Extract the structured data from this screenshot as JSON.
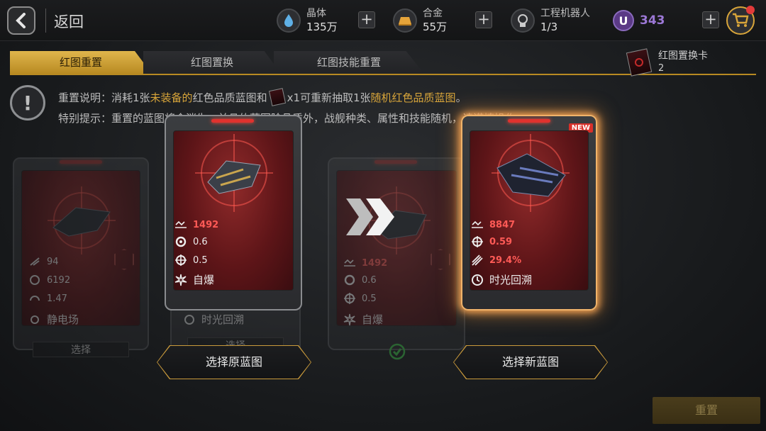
{
  "topbar": {
    "back_label": "返回",
    "resources": [
      {
        "name": "晶体",
        "value": "135万",
        "icon": "crystal-icon"
      },
      {
        "name": "合金",
        "value": "55万",
        "icon": "alloy-icon"
      },
      {
        "name": "工程机器人",
        "value": "1/3",
        "icon": "robot-icon"
      }
    ],
    "currency_u": {
      "icon_letter": "U",
      "value": "343"
    }
  },
  "tabs": [
    {
      "label": "红图重置",
      "active": true
    },
    {
      "label": "红图置换",
      "active": false
    },
    {
      "label": "红图技能重置",
      "active": false
    }
  ],
  "item": {
    "name": "红图置换卡",
    "count": "2"
  },
  "notice": {
    "line1": {
      "a": "重置说明：消耗1张",
      "b": "未装备的",
      "c": "红色品质蓝图和",
      "d": "x1可重新抽取1张",
      "e": "随机红色品质蓝图",
      "f": "。"
    },
    "line2": "特别提示：重置的蓝图将会消失，并且的蓝图除品质外，战舰种类、属性和技能随机，请谨慎操作"
  },
  "cards": {
    "left_back": {
      "stats": [
        "94",
        "6192",
        "1.47"
      ],
      "skill": "静电场",
      "select": "选择"
    },
    "original": {
      "power": "1492",
      "stat1": "0.6",
      "stat2": "0.5",
      "skill": "自爆"
    },
    "original_under": {
      "skill": "时光回溯",
      "select": "选择"
    },
    "middle_back": {
      "power": "1492",
      "stat1": "0.6",
      "stat2": "0.5",
      "skill": "自爆"
    },
    "new": {
      "badge": "NEW",
      "power": "8847",
      "stat1": "0.59",
      "stat2": "29.4%",
      "skill": "时光回溯"
    }
  },
  "buttons": {
    "select_original": "选择原蓝图",
    "select_new": "选择新蓝图",
    "reset": "重置"
  },
  "colors": {
    "accent_gold": "#d8a53a",
    "stat_red": "#ff5a56",
    "new_glow": "#f0a052"
  }
}
